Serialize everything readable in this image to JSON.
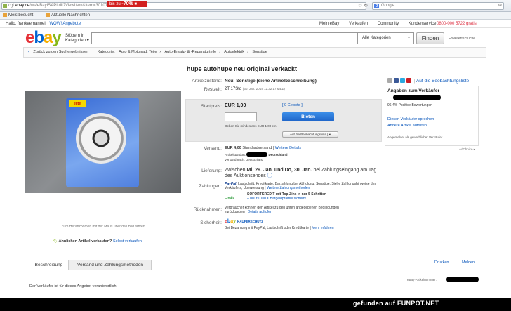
{
  "browser": {
    "url_prefix": "cgi.",
    "url_host": "ebay.de",
    "url_rest": "/ws/eBayISAPI.dll?ViewItem&item=301075897483",
    "search_engine_label": "Google",
    "bookmarks": [
      "Meistbesucht",
      "Aktuelle Nachrichten"
    ]
  },
  "ebay_top": {
    "greeting": "Hallo, frankeemanoel",
    "wow": "WOW! Angebote",
    "promo_prefix": "bis zu",
    "promo_value": "-70%",
    "links": [
      "Mein eBay",
      "Verkaufen",
      "Community",
      "Kundenservice"
    ],
    "phone": "0800-000 5722 gratis"
  },
  "header": {
    "browse_l1": "Stöbern in",
    "browse_l2": "Kategorien",
    "category_select": "Alle Kategorien",
    "find_button": "Finden",
    "advanced_search": "Erweiterte Suche"
  },
  "breadcrumb": {
    "back": "Zurück zu den Suchergebnissen",
    "label": "Kategorie:",
    "items": [
      "Auto & Motorrad: Teile",
      "Auto-Ersatz- & -Reparaturteile",
      "Autoelektrik",
      "Sonstige"
    ]
  },
  "item": {
    "title": "hupe autohupe neu original verkackt",
    "photo_caption": "Zum Heranzoomen mit der Maus über das Bild fahren",
    "pack_label": "elite",
    "condition_label": "Artikelzustand:",
    "condition_value": "Neu: Sonstige (siehe Artikelbeschreibung)",
    "remaining_label": "Restzeit:",
    "remaining_value": "2T 17Std",
    "remaining_date": "(30. Jan. 2014  12:32:17 MEZ)",
    "start_label": "Startpreis:",
    "price": "EUR 1,00",
    "bids": "[ 0 Gebote ]",
    "bid_button": "Bieten",
    "min_bid": "Geben Sie mindestens EUR 1,00 ein",
    "watchlist_button": "Auf die Beobachtungsliste"
  },
  "seller": {
    "share_link": "Auf die Beobachtungsliste",
    "heading": "Angaben zum Verkäufer",
    "rating": "96,4% Positive Bewertungen",
    "contact": "Diesen Verkäufer sprechen",
    "other_items": "Andere Artikel aufrufen",
    "member_since": "Angemeldet als gewerblicher Verkäufer",
    "adchoice": "AdChoice"
  },
  "shipping": {
    "label": "Versand:",
    "price": "EUR 4,00",
    "method": "Standardversand",
    "details": "Weitere Details",
    "location_label": "Artikelstandort:",
    "location_country": "Deutschland",
    "ships_to": "Versand nach: Deutschland"
  },
  "delivery": {
    "label": "Lieferung:",
    "text_prefix": "Zwischen",
    "dates": "Mi, 29. Jan. und Do, 30. Jan.",
    "text_suffix": "bei Zahlungseingang am Tag des Auktionsendes"
  },
  "payment": {
    "label": "Zahlungen:",
    "paypal": "PayPal",
    "methods": ", Lastschrift, Kreditkarte, Barzahlung bei Abholung, Sonstige. Siehe Zahlungshinweise des Verkäufers, Überweisung",
    "more": "Weitere Zahlungsmethoden",
    "credit_logo": "Credit",
    "credit_l1": "SOFORTKREDIT mit Top-Zins in nur 5 Schritten",
    "credit_l2": "+ bis zu 100 € Bargeldprämie sichern!"
  },
  "returns": {
    "label": "Rücknahmen:",
    "text": "Verbraucher können den Artikel zu den unten angegebenen Bedingungen zurückgeben",
    "link": "Details aufrufen"
  },
  "security": {
    "label": "Sicherheit:",
    "kaeuferschutz": "KÄUFERSCHUTZ",
    "text": "Bei Bezahlung mit PayPal, Lastschrift oder Kreditkarte",
    "link": "Mehr erfahren"
  },
  "similar": {
    "question": "Ähnlichen Artikel verkaufen?",
    "link": "Selbst verkaufen"
  },
  "tabs": {
    "description": "Beschreibung",
    "shipping": "Versand und Zahlungsmethoden",
    "print": "Drucken",
    "report": "Melden",
    "artnr": "eBay-Artikelnummer:",
    "responsible": "Der Verkäufer ist für dieses Angebot verantwortlich."
  },
  "watermark": "gefunden auf  FUNPOT.NET"
}
